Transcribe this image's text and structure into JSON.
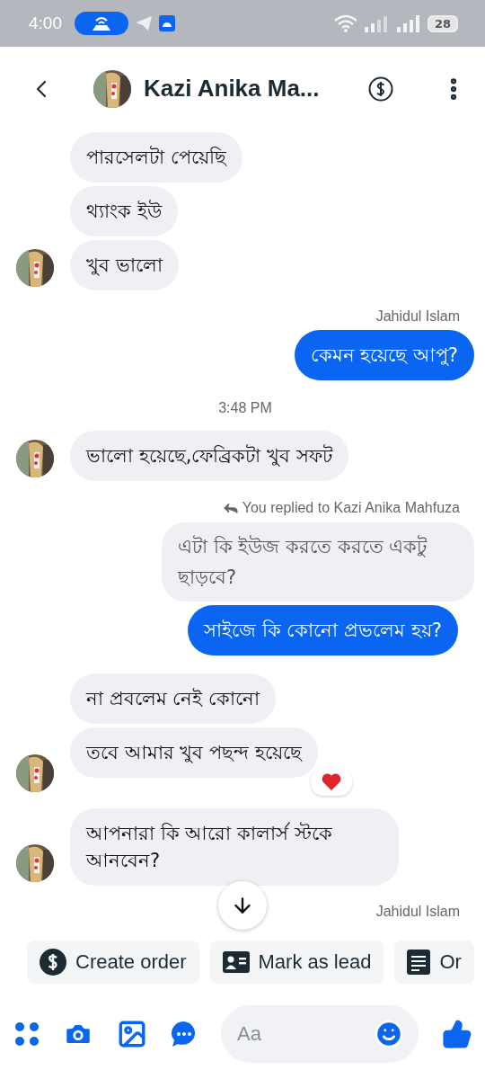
{
  "status_bar": {
    "time": "4:00",
    "battery": "28"
  },
  "header": {
    "name": "Kazi Anika Ma..."
  },
  "messages": [
    {
      "kind": "incoming",
      "items": [
        {
          "text": "পারসেলটা পেয়েছি",
          "reacted": false
        },
        {
          "text": "থ্যাংক ইউ",
          "reacted": false
        },
        {
          "text": "খুব ভালো",
          "reacted": false
        }
      ]
    },
    {
      "kind": "sender",
      "text": "Jahidul Islam"
    },
    {
      "kind": "outgoing",
      "items": [
        {
          "text": "কেমন হয়েছে আপু?",
          "reacted": false
        }
      ]
    },
    {
      "kind": "time",
      "text": "3:48 PM"
    },
    {
      "kind": "incoming",
      "items": [
        {
          "text": "ভালো হয়েছে,ফেব্রিকটা খুব সফট",
          "reacted": false
        }
      ]
    },
    {
      "kind": "reply",
      "label": "You replied to Kazi Anika Mahfuza",
      "quoted": "এটা কি ইউজ করতে করতে একটু ছাড়বে?",
      "text": "সাইজে কি কোনো প্রভলেম হয়?"
    },
    {
      "kind": "incoming",
      "items": [
        {
          "text": "না প্রবলেম নেই কোনো",
          "reacted": false
        },
        {
          "text": "তবে আমার খুব পছন্দ হয়েছে",
          "reacted": true
        }
      ]
    },
    {
      "kind": "incoming",
      "items": [
        {
          "text": "আপনারা কি আরো কালার্স স্টকে আনবেন?",
          "reacted": false
        }
      ]
    },
    {
      "kind": "sender",
      "text": "Jahidul Islam"
    }
  ],
  "quick_actions": [
    {
      "kind": "dollar",
      "label": "Create order"
    },
    {
      "kind": "lead",
      "label": "Mark as lead"
    },
    {
      "kind": "list",
      "label": "Or"
    }
  ],
  "composer": {
    "placeholder": "Aa"
  }
}
